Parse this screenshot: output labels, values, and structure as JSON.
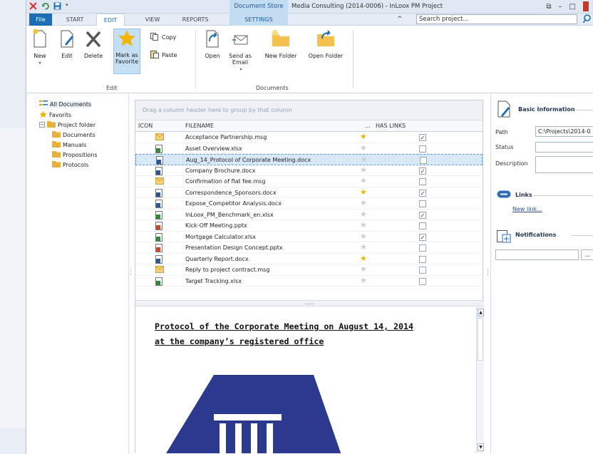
{
  "window": {
    "context_label": "Document Store",
    "title": "Media Consulting (2014-0006) - InLoox PM Project",
    "restore_symbol": "⧉",
    "minimize_symbol": "–",
    "maximize_symbol": "□"
  },
  "tabs": {
    "file": "File",
    "start": "START",
    "edit": "EDIT",
    "view": "VIEW",
    "reports": "REPORTS",
    "settings": "SETTINGS"
  },
  "search": {
    "placeholder": "Search project..."
  },
  "ribbon": {
    "edit_group": {
      "label": "Edit",
      "new": "New",
      "edit": "Edit",
      "delete": "Delete",
      "mark_favorite": "Mark as Favorite",
      "copy": "Copy",
      "paste": "Paste"
    },
    "documents_group": {
      "label": "Documents",
      "open": "Open",
      "send_email": "Send as Email",
      "new_folder": "New Folder",
      "open_folder": "Open Folder"
    }
  },
  "tree": {
    "all_documents": "All Documents",
    "favorits": "Favorits",
    "project_folder": "Project folder",
    "children": [
      "Documents",
      "Manuals",
      "Propositions",
      "Protocols"
    ]
  },
  "grid": {
    "group_hint": "Drag a column header here to group by that column",
    "columns": {
      "icon": "ICON",
      "filename": "FILENAME",
      "dots": "...",
      "has_links": "HAS LINKS"
    },
    "rows": [
      {
        "name": "Acceptance Partnership.msg",
        "type": "msg",
        "fav": true,
        "links": true
      },
      {
        "name": "Asset Overview.xlsx",
        "type": "xlsx",
        "fav": false,
        "links": false
      },
      {
        "name": "Aug_14_Protocol of Corporate Meeting.docx",
        "type": "docx",
        "fav": false,
        "links": false,
        "selected": true
      },
      {
        "name": "Company Brochure.docx",
        "type": "docx",
        "fav": false,
        "links": true
      },
      {
        "name": "Confirmation of flat fee.msg",
        "type": "msg",
        "fav": false,
        "links": false
      },
      {
        "name": "Correspondence_Sponsors.docx",
        "type": "docx",
        "fav": true,
        "links": true
      },
      {
        "name": "Expose_Competitor Analysis.docx",
        "type": "docx",
        "fav": false,
        "links": false
      },
      {
        "name": "InLoox_PM_Benchmark_en.xlsx",
        "type": "xlsx",
        "fav": false,
        "links": true
      },
      {
        "name": "Kick-Off Meeting.pptx",
        "type": "pptx",
        "fav": false,
        "links": false
      },
      {
        "name": "Mortgage Calculator.xlsx",
        "type": "xlsx",
        "fav": false,
        "links": true
      },
      {
        "name": "Presentation Design Concept.pptx",
        "type": "pptx",
        "fav": false,
        "links": false
      },
      {
        "name": "Quarterly Report.docx",
        "type": "docx",
        "fav": true,
        "links": false
      },
      {
        "name": "Reply to project contract.msg",
        "type": "msg",
        "fav": false,
        "links": false
      },
      {
        "name": "Target Tracking.xlsx",
        "type": "xlsx",
        "fav": false,
        "links": false
      }
    ],
    "splitter_dots": "....."
  },
  "preview": {
    "title": "Protocol of the Corporate Meeting on August 14, 2014 at the company’s registered office"
  },
  "details": {
    "basic_info": "Basic Information",
    "path_label": "Path",
    "path_value": "C:\\Projects\\2014-0",
    "status_label": "Status",
    "description_label": "Description",
    "links_title": "Links",
    "new_link": "New link...",
    "notifications_title": "Notifications",
    "more_button": "..."
  },
  "colors": {
    "accent": "#1e6cb4",
    "context_tab": "#c4dcf2",
    "star": "#f4b400",
    "selection": "#d9e8f7",
    "logo_blue": "#2b3a8f"
  }
}
